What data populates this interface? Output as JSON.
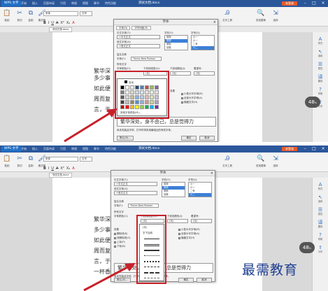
{
  "app": {
    "menu_button": "WPS 文字",
    "menu_items": [
      "开始",
      "插入",
      "页面布局",
      "引用",
      "审阅",
      "视图",
      "章节",
      "特色功能"
    ],
    "doc_title": "测试文档.docx",
    "login_button": "未登录"
  },
  "ribbon": {
    "paste": "粘贴",
    "cut": "剪切",
    "copy": "复制",
    "format_painter": "格式刷",
    "font_name": "宋体",
    "font_size": "五号",
    "format_marks": [
      "B",
      "I",
      "U",
      "A",
      "X²",
      "X₂",
      "A"
    ],
    "find_replace": "查找替换",
    "select": "选择",
    "text_tools": "文字工具",
    "styles": "样式",
    "doc_tab": "测试文档.docx"
  },
  "sidebar": [
    "样式",
    "选择",
    "属性",
    "翻译",
    "帮助",
    "分享"
  ],
  "badges": {
    "top": {
      "value": "48",
      "unit": "%"
    },
    "bottom": {
      "value": "48",
      "unit": "%"
    }
  },
  "dialog": {
    "title": "字体",
    "tabs": [
      "字体(N)",
      "字符间距(R)"
    ],
    "chinese_font_label": "中文字体(T):",
    "chinese_font_value": "+中文正文",
    "western_font_label": "西文字体(X):",
    "western_font_value": "+西文正文",
    "style_label": "字形(Y):",
    "style_items": [
      "常规",
      "倾斜",
      "加粗"
    ],
    "size_label": "字号(S):",
    "size_items": [
      "小一",
      "二号",
      "小二"
    ],
    "complex_label": "复杂文种",
    "complex_font_label": "字体(F):",
    "complex_font_value": "Times New Roman",
    "all_text_label": "所有文字",
    "font_color_label": "字体颜色(C):",
    "underline_type_label": "下划线线型(U):",
    "underline_color_label": "下划线颜色(I):",
    "emphasis_label": "着重号:",
    "none": "(无)",
    "effects_label": "效果",
    "effects_left": [
      "删除线(K)",
      "双删除线(G)",
      "上标(P)",
      "下标(B)"
    ],
    "effects_right": [
      "小型大写字母(M)",
      "全部大写字母(A)",
      "隐藏文字(H)"
    ],
    "preview_label": "预览",
    "preview_text": "繁华深处，身不由己，总是觉得力",
    "preview_note": "尚未安装此字体，打印时将采用最相近的有效字体。",
    "default_button": "默认(D)...",
    "ok_button": "确定",
    "cancel_button": "取消"
  },
  "color_palette": {
    "auto_label": "自动",
    "more_label": "其他字体颜色(M)...",
    "rows": [
      [
        "#000000",
        "#ffffff",
        "#eeece1",
        "#1f497d",
        "#4f81bd",
        "#c0504d",
        "#9bbb59",
        "#8064a2"
      ],
      [
        "#7f7f7f",
        "#f2f2f2",
        "#ddd9c3",
        "#c6d9f0",
        "#dbe5f1",
        "#f2dcdb",
        "#ebf1dd",
        "#e5e0ec"
      ],
      [
        "#595959",
        "#d8d8d8",
        "#c4bd97",
        "#8db3e2",
        "#b8cce4",
        "#e5b9b7",
        "#d7e3bc",
        "#ccc1d9"
      ],
      [
        "#3f3f3f",
        "#bfbfbf",
        "#938953",
        "#548dd4",
        "#95b3d7",
        "#d99694",
        "#c3d69b",
        "#b2a2c7"
      ],
      [
        "#c00000",
        "#ff0000",
        "#ffc000",
        "#ffff00",
        "#92d050",
        "#00b050",
        "#00b0f0",
        "#7030a0"
      ]
    ]
  },
  "underline_dropdown": {
    "items": [
      "(无)",
      "字下加线"
    ]
  },
  "document": {
    "shot1_lines": [
      "繁华深",
      "多少事",
      "如此便",
      "周而复",
      "言，于"
    ],
    "shot2_lines": [
      "繁华深",
      "多少事",
      "如此便",
      "周而复",
      "言，于",
      "一杯香"
    ]
  },
  "watermark": "最需教育"
}
